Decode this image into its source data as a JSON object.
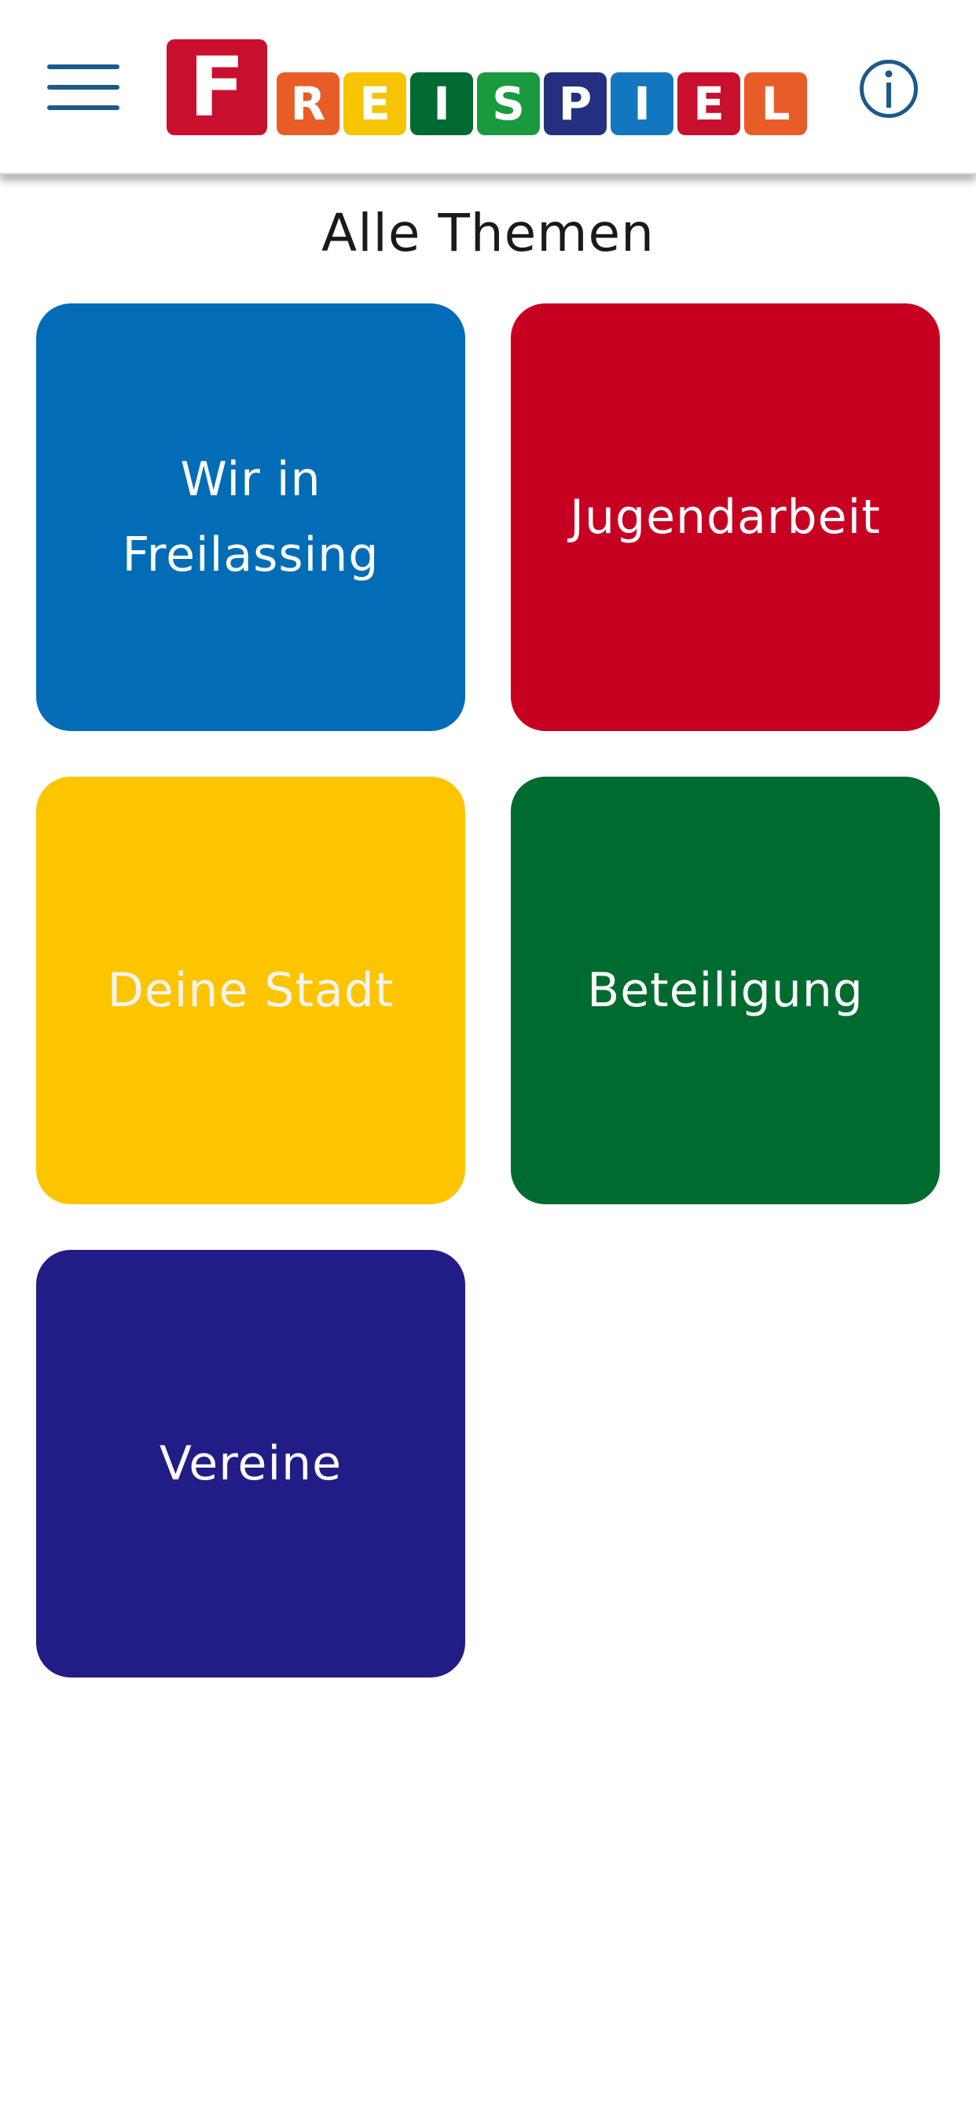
{
  "header": {
    "logo": {
      "text": "FREISPIEL",
      "letters": [
        {
          "char": "F",
          "color": "#c8102e"
        },
        {
          "char": "R",
          "color": "#e85c27"
        },
        {
          "char": "E",
          "color": "#f6c400"
        },
        {
          "char": "I",
          "color": "#006a31"
        },
        {
          "char": "S",
          "color": "#1a9a3e"
        },
        {
          "char": "P",
          "color": "#22307f"
        },
        {
          "char": "I",
          "color": "#1277be"
        },
        {
          "char": "E",
          "color": "#c8102e"
        },
        {
          "char": "L",
          "color": "#e85c27"
        }
      ]
    },
    "menu_icon": "hamburger-icon",
    "info_icon": "info-icon",
    "accent_color": "#1b5a8a"
  },
  "page": {
    "title": "Alle Themen"
  },
  "topics": [
    {
      "label": "Wir in Freilassing",
      "bg": "#036cb7",
      "fg": "#ffffff"
    },
    {
      "label": "Jugendarbeit",
      "bg": "#c70022",
      "fg": "#ffffff"
    },
    {
      "label": "Deine Stadt",
      "bg": "#fdc500",
      "fg": "#f3f3f3"
    },
    {
      "label": "Beteiligung",
      "bg": "#006b2f",
      "fg": "#ffffff"
    },
    {
      "label": "Vereine",
      "bg": "#221c86",
      "fg": "#ffffff"
    }
  ]
}
